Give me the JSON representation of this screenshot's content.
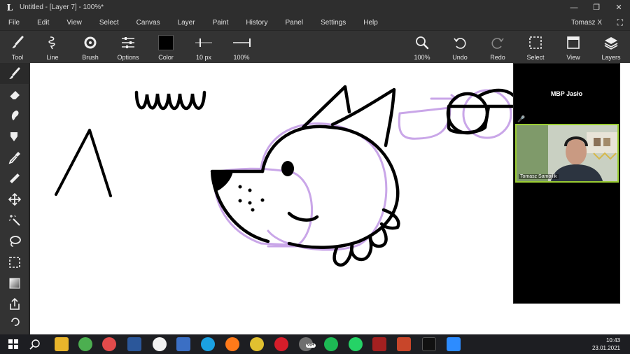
{
  "window": {
    "app_logo": "L",
    "title": "Untitled - [Layer 7] - 100%*",
    "minimize": "—",
    "maximize": "❐",
    "close": "✕"
  },
  "menubar": {
    "items": [
      "File",
      "Edit",
      "View",
      "Select",
      "Canvas",
      "Layer",
      "Paint",
      "History",
      "Panel",
      "Settings",
      "Help"
    ],
    "user": "Tomasz X",
    "fullscreen": "⛶"
  },
  "toolbar": {
    "tool_label": "Tool",
    "line_label": "Line",
    "brush_label": "Brush",
    "options_label": "Options",
    "color_label": "Color",
    "color_value": "#000000",
    "size_label": "10 px",
    "opacity_label": "100%",
    "zoom_label": "100%",
    "undo_label": "Undo",
    "redo_label": "Redo",
    "select_label": "Select",
    "view_label": "View",
    "layers_label": "Layers"
  },
  "left_tools": [
    "brush-tool-icon",
    "eraser-tool-icon",
    "smudge-tool-icon",
    "fill-tool-icon",
    "eyedropper-tool-icon",
    "ruler-tool-icon",
    "move-tool-icon",
    "magic-wand-tool-icon",
    "lasso-tool-icon",
    "rect-select-tool-icon",
    "gradient-tool-icon",
    "share-tool-icon"
  ],
  "video": {
    "room_name": "MBP Jasło",
    "participant": "Tomasz Samojlik"
  },
  "taskbar": {
    "time": "10:43",
    "date": "23.01.2021",
    "badge": "99+"
  },
  "colors": {
    "accent_lilac": "#c9a6e8",
    "video_border": "#9acd32"
  }
}
